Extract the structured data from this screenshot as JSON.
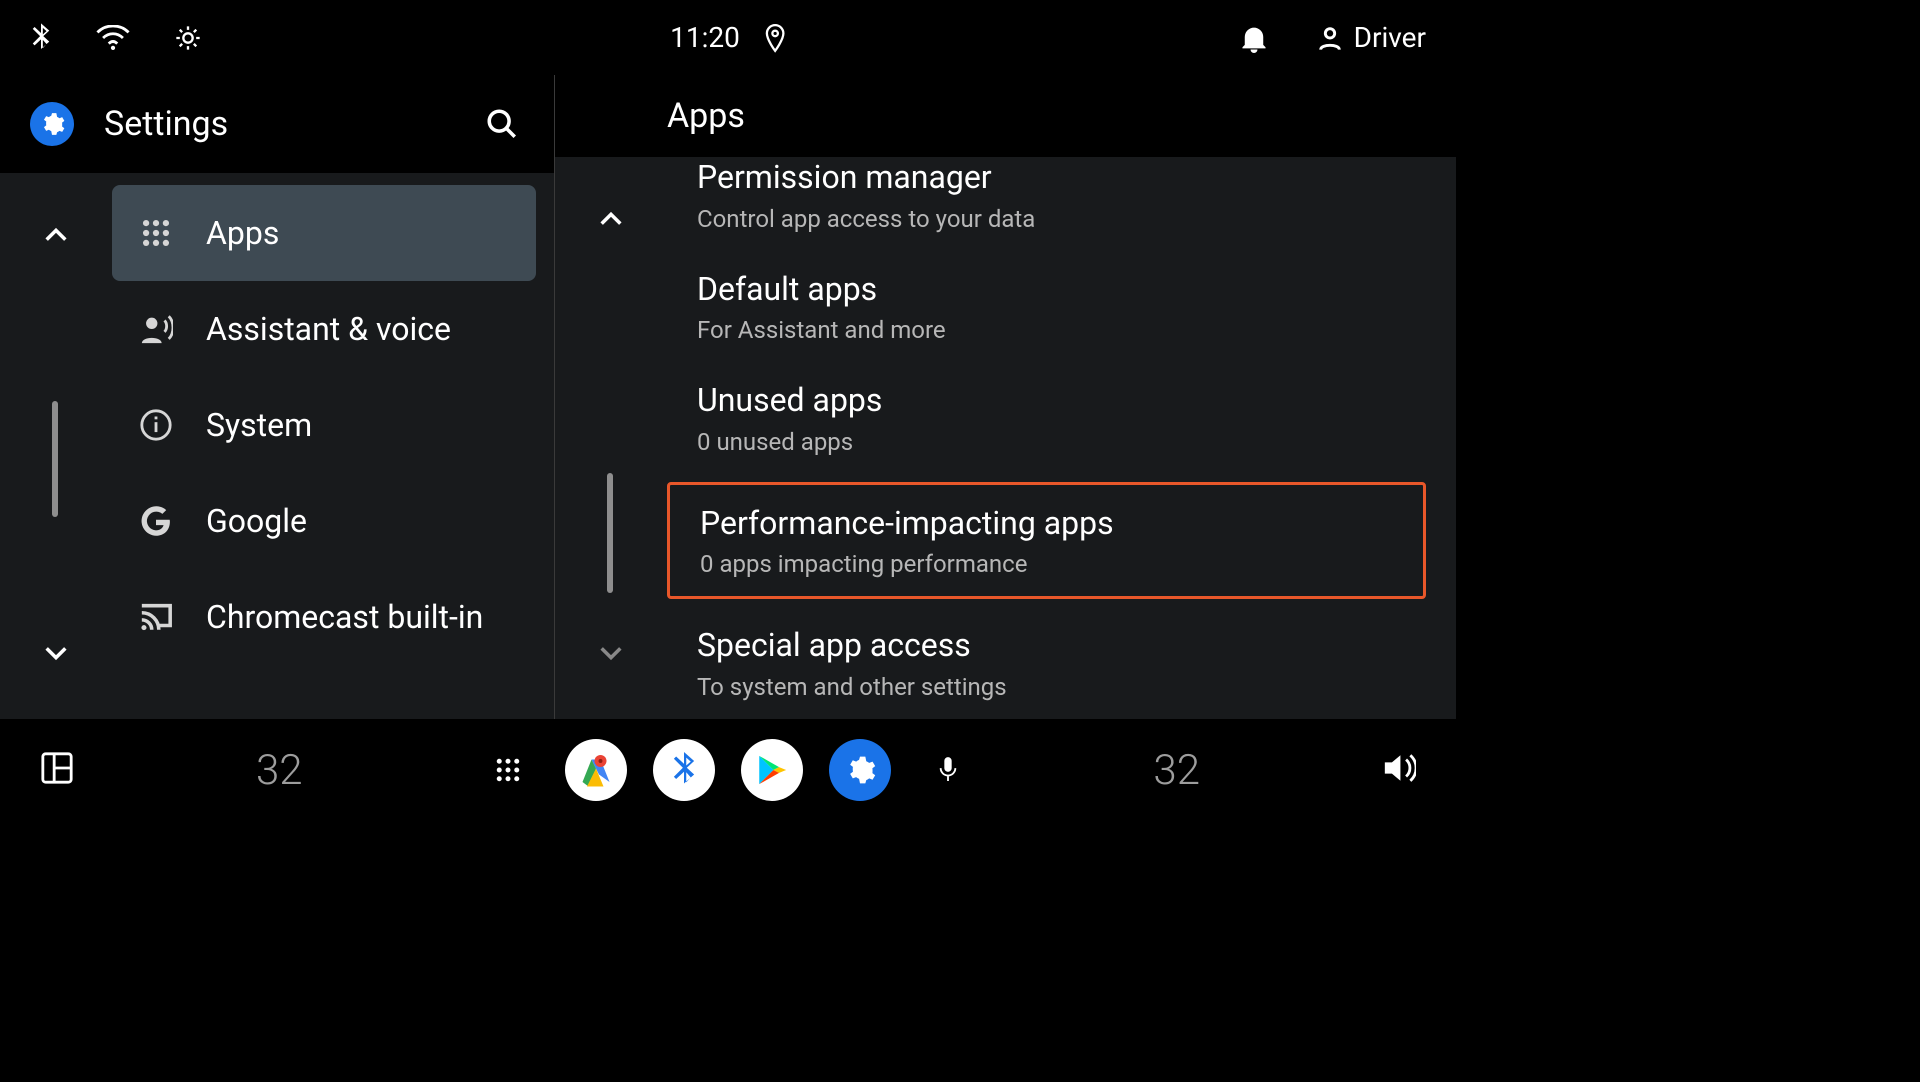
{
  "status": {
    "time": "11:20",
    "user_label": "Driver"
  },
  "sidebar": {
    "title": "Settings",
    "items": [
      {
        "label": "Apps",
        "icon": "grid",
        "selected": true
      },
      {
        "label": "Assistant & voice",
        "icon": "voice",
        "selected": false
      },
      {
        "label": "System",
        "icon": "info",
        "selected": false
      },
      {
        "label": "Google",
        "icon": "google",
        "selected": false
      },
      {
        "label": "Chromecast built-in",
        "icon": "cast",
        "selected": false
      }
    ]
  },
  "detail": {
    "heading": "Apps",
    "items": [
      {
        "title": "Permission manager",
        "sub": "Control app access to your data",
        "cut": true,
        "highlight": false
      },
      {
        "title": "Default apps",
        "sub": "For Assistant and more",
        "cut": false,
        "highlight": false
      },
      {
        "title": "Unused apps",
        "sub": "0 unused apps",
        "cut": false,
        "highlight": false
      },
      {
        "title": "Performance-impacting apps",
        "sub": "0 apps impacting performance",
        "cut": false,
        "highlight": true
      },
      {
        "title": "Special app access",
        "sub": "To system and other settings",
        "cut": false,
        "highlight": false
      }
    ]
  },
  "bottom": {
    "temp_left": "32",
    "temp_right": "32"
  }
}
